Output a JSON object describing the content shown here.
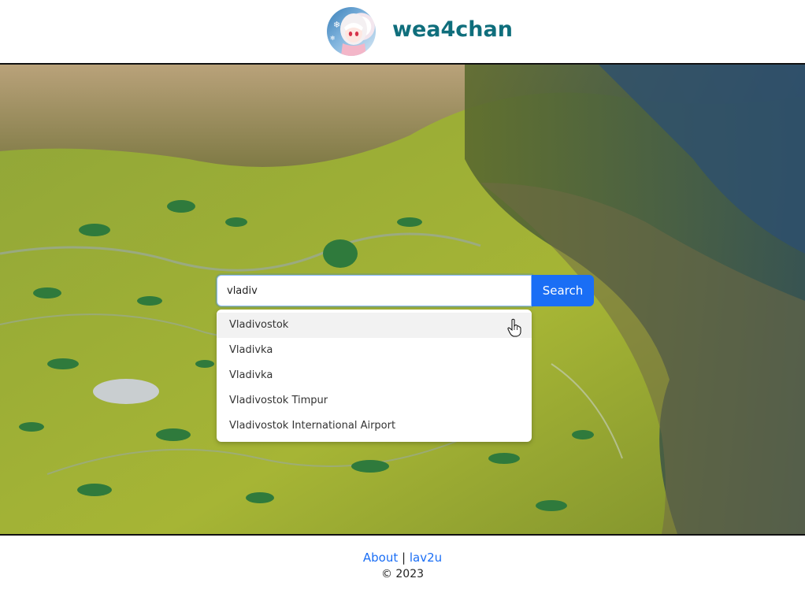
{
  "header": {
    "title": "wea4chan"
  },
  "search": {
    "value": "vladiv",
    "button_label": "Search"
  },
  "suggestions": [
    "Vladivostok",
    "Vladivka",
    "Vladivka",
    "Vladivostok Timpur",
    "Vladivostok International Airport"
  ],
  "footer": {
    "about_label": "About",
    "separator": "|",
    "author_label": "lav2u",
    "copyright": "© 2023"
  },
  "colors": {
    "title": "#0f6e7c",
    "accent": "#1a6ef5"
  }
}
